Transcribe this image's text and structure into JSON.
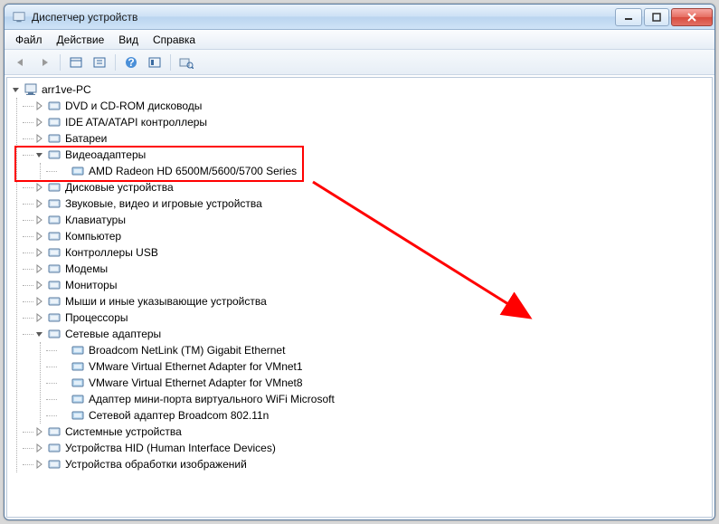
{
  "window": {
    "title": "Диспетчер устройств"
  },
  "menu": {
    "file": "Файл",
    "action": "Действие",
    "view": "Вид",
    "help": "Справка"
  },
  "root": {
    "label": "arr1ve-PC"
  },
  "categories": [
    {
      "label": "DVD и CD-ROM дисководы",
      "expanded": false
    },
    {
      "label": "IDE ATA/ATAPI контроллеры",
      "expanded": false
    },
    {
      "label": "Батареи",
      "expanded": false
    },
    {
      "label": "Видеоадаптеры",
      "expanded": true,
      "highlighted": true,
      "children": [
        {
          "label": "AMD Radeon HD 6500M/5600/5700 Series"
        }
      ]
    },
    {
      "label": "Дисковые устройства",
      "expanded": false
    },
    {
      "label": "Звуковые, видео и игровые устройства",
      "expanded": false
    },
    {
      "label": "Клавиатуры",
      "expanded": false
    },
    {
      "label": "Компьютер",
      "expanded": false
    },
    {
      "label": "Контроллеры USB",
      "expanded": false
    },
    {
      "label": "Модемы",
      "expanded": false
    },
    {
      "label": "Мониторы",
      "expanded": false
    },
    {
      "label": "Мыши и иные указывающие устройства",
      "expanded": false
    },
    {
      "label": "Процессоры",
      "expanded": false
    },
    {
      "label": "Сетевые адаптеры",
      "expanded": true,
      "children": [
        {
          "label": "Broadcom NetLink (TM) Gigabit Ethernet"
        },
        {
          "label": "VMware Virtual Ethernet Adapter for VMnet1"
        },
        {
          "label": "VMware Virtual Ethernet Adapter for VMnet8"
        },
        {
          "label": "Адаптер мини-порта виртуального WiFi Microsoft"
        },
        {
          "label": "Сетевой адаптер Broadcom 802.11n"
        }
      ]
    },
    {
      "label": "Системные устройства",
      "expanded": false
    },
    {
      "label": "Устройства HID (Human Interface Devices)",
      "expanded": false
    },
    {
      "label": "Устройства обработки изображений",
      "expanded": false
    }
  ]
}
